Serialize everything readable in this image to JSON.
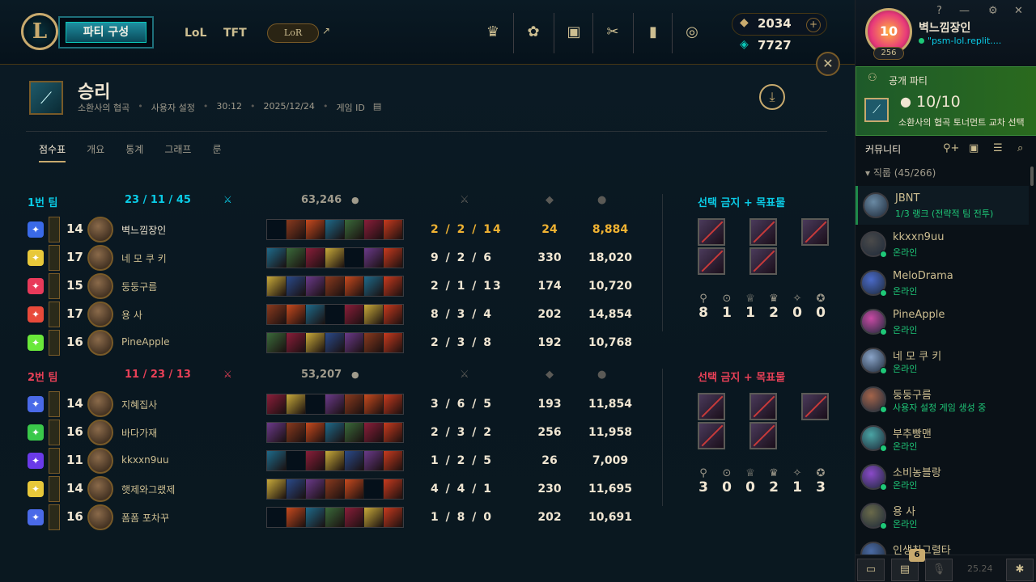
{
  "nav": {
    "play_label": "파티 구성",
    "lol_label": "LoL",
    "tft_label": "TFT",
    "lor_label": "LoR",
    "rp": "2034",
    "be": "7727"
  },
  "result": {
    "title": "승리",
    "map": "소환사의 협곡",
    "mode": "사용자 설정",
    "duration": "30:12",
    "date": "2025/12/24",
    "game_id_label": "게임 ID"
  },
  "tabs": [
    "점수표",
    "개요",
    "통계",
    "그래프",
    "룬"
  ],
  "teams": [
    {
      "name": "1번 팀",
      "kills": "23",
      "deaths": "11",
      "assists": "45",
      "gold": "63,246",
      "color": "#0acbe6",
      "bans_title": "선택 금지 + 목표물",
      "objectives": [
        "8",
        "1",
        "1",
        "2",
        "0",
        "0"
      ],
      "players": [
        {
          "level": "14",
          "name": "벽느낌장인",
          "kda": "2 / 2 / 14",
          "cs": "24",
          "gold": "8,884"
        },
        {
          "level": "17",
          "name": "네 모 쿠 키",
          "kda": "9 / 2 / 6",
          "cs": "330",
          "gold": "18,020"
        },
        {
          "level": "15",
          "name": "둥둥구름",
          "kda": "2 / 1 / 13",
          "cs": "174",
          "gold": "10,720"
        },
        {
          "level": "17",
          "name": "용 사",
          "kda": "8 / 3 / 4",
          "cs": "202",
          "gold": "14,854"
        },
        {
          "level": "16",
          "name": "PineApple",
          "kda": "2 / 3 / 8",
          "cs": "192",
          "gold": "10,768"
        }
      ]
    },
    {
      "name": "2번 팀",
      "kills": "11",
      "deaths": "23",
      "assists": "13",
      "gold": "53,207",
      "color": "#e84057",
      "bans_title": "선택 금지 + 목표물",
      "objectives": [
        "3",
        "0",
        "0",
        "2",
        "1",
        "3"
      ],
      "players": [
        {
          "level": "14",
          "name": "지혜집사",
          "kda": "3 / 6 / 5",
          "cs": "193",
          "gold": "11,854"
        },
        {
          "level": "16",
          "name": "바다가재",
          "kda": "2 / 3 / 2",
          "cs": "256",
          "gold": "11,958"
        },
        {
          "level": "11",
          "name": "kkxxn9uu",
          "kda": "1 / 2 / 5",
          "cs": "26",
          "gold": "7,009"
        },
        {
          "level": "14",
          "name": "햇제와그랬제",
          "kda": "4 / 4 / 1",
          "cs": "230",
          "gold": "11,695"
        },
        {
          "level": "16",
          "name": "폼폼 포차꾸",
          "kda": "1 / 8 / 0",
          "cs": "202",
          "gold": "10,691"
        }
      ]
    }
  ],
  "side": {
    "summoner": "벽느낌장인",
    "status": "\"psm-lol.replit....",
    "level": "256",
    "party_label": "공개 파티",
    "party_count": "10/10",
    "party_mode": "소환사의 협곡 토너먼트 교차 선택",
    "community": "커뮤니티",
    "group": "직룹 (45/266)",
    "friends": [
      {
        "name": "JBNT",
        "status": "1/3 랭크 (전략적 팀 전투)"
      },
      {
        "name": "kkxxn9uu",
        "status": "온라인"
      },
      {
        "name": "MeloDrama",
        "status": "온라인"
      },
      {
        "name": "PineApple",
        "status": "온라인"
      },
      {
        "name": "네 모 쿠 키",
        "status": "온라인"
      },
      {
        "name": "둥둥구름",
        "status": "사용자 설정 게임 생성 중"
      },
      {
        "name": "부추빵맨",
        "status": "온라인"
      },
      {
        "name": "소비농블랑",
        "status": "온라인"
      },
      {
        "name": "용 사",
        "status": "온라인"
      },
      {
        "name": "인생최그렬타",
        "status": ""
      }
    ],
    "badge": "6",
    "version": "25.24"
  },
  "colors": {
    "gold": "#c8aa6e",
    "accent": "#0acbe6",
    "red": "#e84057",
    "online": "#1ec878",
    "highlight": "#f0b232"
  }
}
